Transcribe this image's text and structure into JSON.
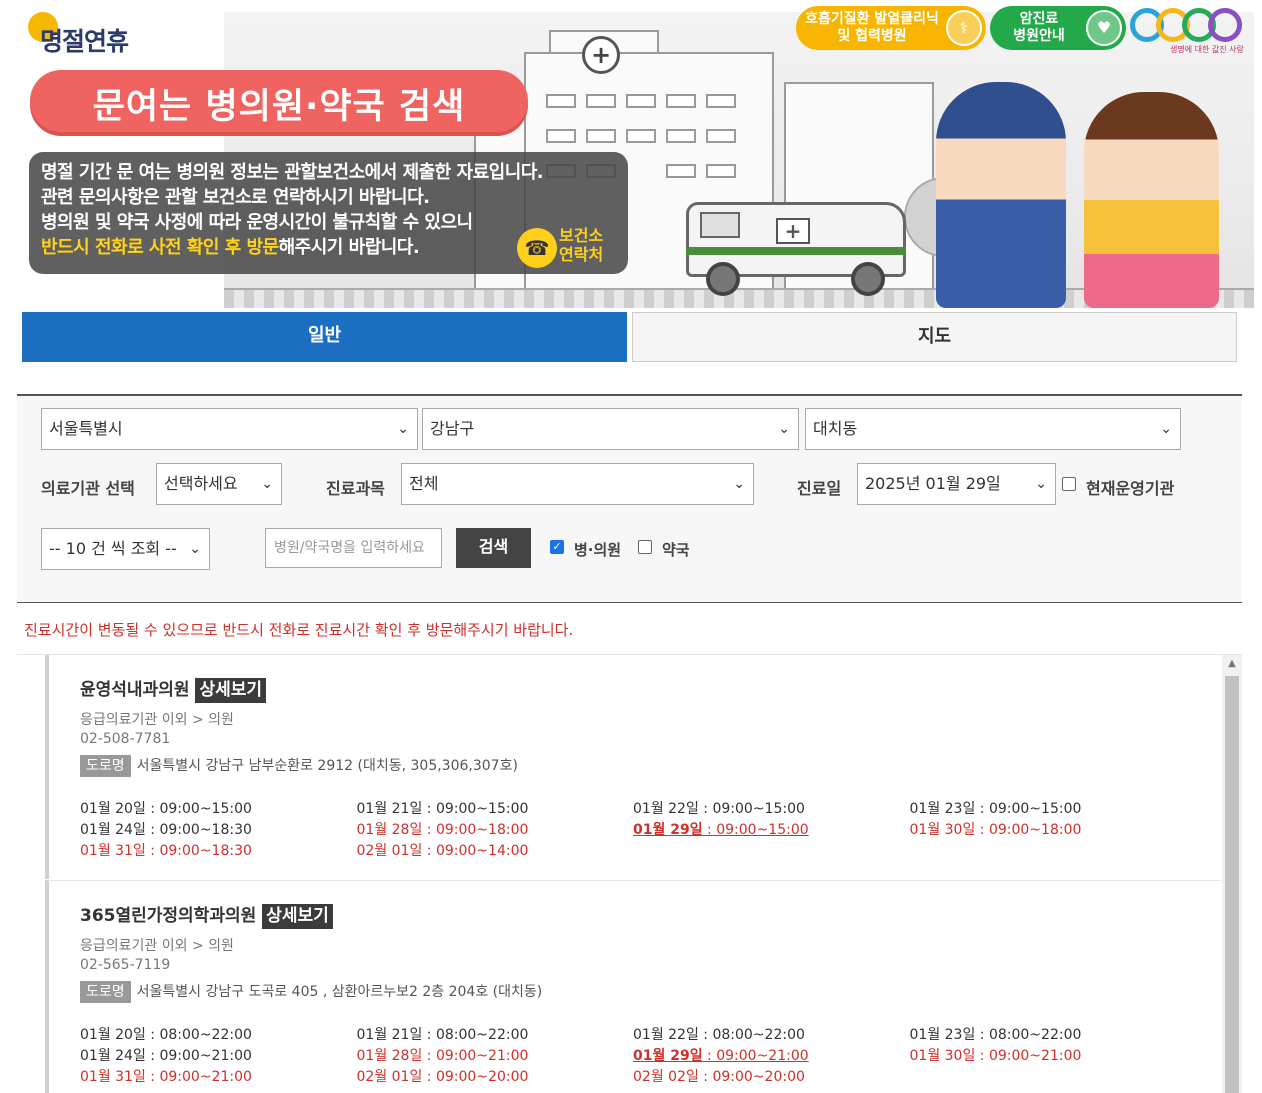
{
  "banner": {
    "logo_text": "명절연휴",
    "title": "문여는 병의원·약국 검색",
    "notice_lines": [
      "명절 기간 문 여는 병의원 정보는 관할보건소에서 제출한 자료입니다.",
      "관련 문의사항은 관할 보건소로 연락하시기 바랍니다.",
      "병의원 및 약국 사정에 따라 운영시간이 불규칙할 수 있으니"
    ],
    "notice_highlight": "반드시 전화로 사전 확인 후 방문",
    "notice_tail": "해주시기 바랍니다.",
    "phone_badge_line1": "보건소",
    "phone_badge_line2": "연락처",
    "top_buttons": [
      {
        "line1": "호흡기질환 발열클리닉",
        "line2": "및 협력병원",
        "icon": "stethoscope-icon",
        "color": "#f7b500"
      },
      {
        "line1": "암진료",
        "line2": "병원안내",
        "icon": "ribbon-icon",
        "color": "#23a94a"
      }
    ],
    "egen_logo": "e-Gen",
    "egen_tagline": "생명에 대한 값진 사랑"
  },
  "tabs": [
    {
      "label": "일반",
      "active": true
    },
    {
      "label": "지도",
      "active": false
    }
  ],
  "search": {
    "sido": "서울특별시",
    "sigungu": "강남구",
    "dong": "대치동",
    "institution_label": "의료기관 선택",
    "institution_value": "선택하세요",
    "subject_label": "진료과목",
    "subject_value": "전체",
    "date_label": "진료일",
    "date_value": "2025년 01월 29일",
    "open_now_label": "현재운영기관",
    "open_now_checked": false,
    "page_size": "-- 10 건 씩 조회 --",
    "name_placeholder": "병원/약국명을 입력하세요",
    "search_button": "검색",
    "hospital_label": "병·의원",
    "hospital_checked": true,
    "pharmacy_label": "약국",
    "pharmacy_checked": false
  },
  "warning_text": "진료시간이 변동될 수 있으므로 반드시 전화로 진료시간 확인 후 방문해주시기 바랍니다.",
  "results": [
    {
      "name": "윤영석내과의원",
      "detail_label": "상세보기",
      "category": "응급의료기관 이외 > 의원",
      "phone": "02-508-7781",
      "road_tag": "도로명",
      "address": "서울특별시 강남구 남부순환로 2912 (대치동, 305,306,307호)",
      "schedule": [
        {
          "date": "01월 20일",
          "hours": "09:00~15:00",
          "style": "normal"
        },
        {
          "date": "01월 21일",
          "hours": "09:00~15:00",
          "style": "normal"
        },
        {
          "date": "01월 22일",
          "hours": "09:00~15:00",
          "style": "normal"
        },
        {
          "date": "01월 23일",
          "hours": "09:00~15:00",
          "style": "normal"
        },
        {
          "date": "01월 24일",
          "hours": "09:00~18:30",
          "style": "normal"
        },
        {
          "date": "01월 28일",
          "hours": "09:00~18:00",
          "style": "red"
        },
        {
          "date": "01월 29일",
          "hours": "09:00~15:00",
          "style": "today"
        },
        {
          "date": "01월 30일",
          "hours": "09:00~18:00",
          "style": "red"
        },
        {
          "date": "01월 31일",
          "hours": "09:00~18:30",
          "style": "red"
        },
        {
          "date": "02월 01일",
          "hours": "09:00~14:00",
          "style": "red"
        }
      ]
    },
    {
      "name": "365열린가정의학과의원",
      "detail_label": "상세보기",
      "category": "응급의료기관 이외 > 의원",
      "phone": "02-565-7119",
      "road_tag": "도로명",
      "address": "서울특별시 강남구 도곡로 405 , 삼환아르누보2 2층 204호 (대치동)",
      "schedule": [
        {
          "date": "01월 20일",
          "hours": "08:00~22:00",
          "style": "normal"
        },
        {
          "date": "01월 21일",
          "hours": "08:00~22:00",
          "style": "normal"
        },
        {
          "date": "01월 22일",
          "hours": "08:00~22:00",
          "style": "normal"
        },
        {
          "date": "01월 23일",
          "hours": "08:00~22:00",
          "style": "normal"
        },
        {
          "date": "01월 24일",
          "hours": "09:00~21:00",
          "style": "normal"
        },
        {
          "date": "01월 28일",
          "hours": "09:00~21:00",
          "style": "red"
        },
        {
          "date": "01월 29일",
          "hours": "09:00~21:00",
          "style": "today"
        },
        {
          "date": "01월 30일",
          "hours": "09:00~21:00",
          "style": "red"
        },
        {
          "date": "01월 31일",
          "hours": "09:00~21:00",
          "style": "red"
        },
        {
          "date": "02월 01일",
          "hours": "09:00~20:00",
          "style": "red"
        },
        {
          "date": "02월 02일",
          "hours": "09:00~20:00",
          "style": "red"
        }
      ]
    }
  ]
}
